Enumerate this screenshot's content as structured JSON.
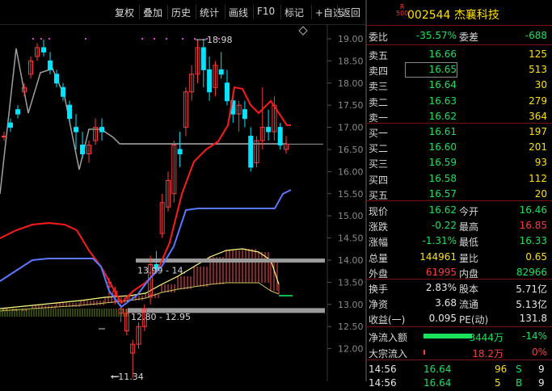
{
  "toolbar": {
    "buttons": [
      "复权",
      "叠加",
      "历史",
      "统计",
      "画线",
      "F10",
      "标记",
      "+自选",
      "返回"
    ]
  },
  "chart": {
    "price_ticks": [
      "19.00",
      "18.50",
      "18.00",
      "17.50",
      "17.00",
      "16.50",
      "16.00",
      "15.50",
      "15.00",
      "14.50",
      "14.00",
      "13.50",
      "13.00",
      "12.50",
      "12.00"
    ],
    "label_high": "18.98",
    "label_mid": "13.99 - 14.",
    "label_band": "12.80 - 12.95",
    "label_low": "11.34",
    "ref_line_price": 16.62,
    "upper_band_price": 14.0,
    "lower_band_price": 12.88,
    "colors": {
      "up": "#ff3b3b",
      "down": "#00e5ff",
      "ma_short": "#ff1a1a",
      "ma_long": "#5a78ff",
      "ma_gray": "#a0a0a0",
      "cloud": "#ffff80",
      "bars": "#ff5050"
    },
    "candles": [
      [
        16.8,
        16.9,
        16.7,
        16.8
      ],
      [
        17.1,
        17.2,
        16.9,
        17.0
      ],
      [
        17.4,
        17.5,
        17.2,
        17.3
      ],
      [
        17.8,
        18.0,
        17.7,
        17.9
      ],
      [
        18.2,
        18.6,
        18.1,
        18.5
      ],
      [
        18.6,
        18.9,
        18.5,
        18.8
      ],
      [
        18.8,
        18.98,
        18.6,
        18.7
      ],
      [
        18.5,
        18.7,
        18.2,
        18.3
      ],
      [
        18.2,
        18.3,
        17.9,
        18.0
      ],
      [
        17.9,
        18.0,
        17.6,
        17.7
      ],
      [
        17.5,
        17.6,
        17.1,
        17.2
      ],
      [
        17.0,
        17.3,
        16.5,
        16.9
      ],
      [
        16.6,
        16.9,
        16.3,
        16.4
      ],
      [
        16.4,
        16.7,
        16.2,
        16.6
      ],
      [
        16.7,
        17.2,
        16.6,
        17.0
      ],
      [
        17.0,
        17.2,
        16.7,
        16.9
      ],
      [
        13.4,
        13.6,
        13.2,
        13.5
      ],
      [
        13.2,
        13.4,
        13.0,
        13.3
      ],
      [
        12.8,
        13.0,
        12.6,
        12.9
      ],
      [
        12.4,
        12.9,
        12.3,
        12.8
      ],
      [
        11.9,
        12.2,
        11.34,
        12.1
      ],
      [
        12.1,
        12.6,
        12.0,
        12.5
      ],
      [
        12.5,
        13.0,
        12.4,
        12.9
      ],
      [
        13.2,
        14.1,
        13.0,
        13.9
      ],
      [
        13.9,
        14.2,
        13.7,
        13.8
      ],
      [
        14.6,
        15.5,
        14.5,
        15.3
      ],
      [
        15.2,
        16.0,
        15.1,
        15.8
      ],
      [
        15.5,
        16.7,
        15.3,
        16.6
      ],
      [
        16.5,
        16.9,
        16.1,
        16.4
      ],
      [
        17.0,
        17.9,
        16.8,
        17.8
      ],
      [
        17.8,
        18.4,
        17.6,
        18.2
      ],
      [
        18.2,
        18.98,
        18.0,
        18.8
      ],
      [
        18.8,
        19.0,
        17.9,
        18.3
      ],
      [
        18.3,
        18.6,
        17.6,
        17.8
      ],
      [
        17.9,
        18.5,
        17.7,
        18.4
      ],
      [
        18.3,
        18.7,
        18.1,
        18.2
      ],
      [
        18.0,
        18.3,
        17.5,
        17.6
      ],
      [
        17.6,
        17.8,
        17.1,
        17.3
      ],
      [
        17.3,
        17.6,
        16.9,
        17.5
      ],
      [
        17.4,
        17.6,
        17.0,
        17.2
      ],
      [
        16.8,
        17.0,
        16.0,
        16.1
      ],
      [
        16.2,
        16.8,
        16.1,
        16.7
      ],
      [
        16.7,
        17.9,
        16.5,
        17.0
      ],
      [
        17.0,
        17.4,
        16.7,
        16.9
      ],
      [
        16.9,
        17.7,
        16.7,
        17.5
      ],
      [
        17.0,
        17.1,
        16.5,
        16.6
      ],
      [
        16.5,
        16.8,
        16.4,
        16.62
      ]
    ]
  },
  "panel": {
    "r_label": "R",
    "r_sub": "500",
    "title": "002544 杰襄科技",
    "weibi": {
      "label": "委比",
      "value": "-35.57%",
      "label2": "委差",
      "value2": "-688"
    },
    "sell": [
      {
        "label": "卖五",
        "price": "16.66",
        "vol": "125"
      },
      {
        "label": "卖四",
        "price": "16.65",
        "vol": "513"
      },
      {
        "label": "卖三",
        "price": "16.64",
        "vol": "30"
      },
      {
        "label": "卖二",
        "price": "16.63",
        "vol": "279"
      },
      {
        "label": "卖一",
        "price": "16.62",
        "vol": "364"
      }
    ],
    "buy": [
      {
        "label": "买一",
        "price": "16.61",
        "vol": "197"
      },
      {
        "label": "买二",
        "price": "16.60",
        "vol": "201"
      },
      {
        "label": "买三",
        "price": "16.59",
        "vol": "93"
      },
      {
        "label": "买四",
        "price": "16.58",
        "vol": "112"
      },
      {
        "label": "买五",
        "price": "16.57",
        "vol": "20"
      }
    ],
    "quote": [
      {
        "l1": "现价",
        "v1": "16.62",
        "c1": "green",
        "l2": "今开",
        "v2": "16.46",
        "c2": "green"
      },
      {
        "l1": "涨跌",
        "v1": "-0.22",
        "c1": "green",
        "l2": "最高",
        "v2": "16.85",
        "c2": "red"
      },
      {
        "l1": "涨幅",
        "v1": "-1.31%",
        "c1": "green",
        "l2": "最低",
        "v2": "16.33",
        "c2": "green"
      },
      {
        "l1": "总量",
        "v1": "144961",
        "c1": "yellow",
        "l2": "量比",
        "v2": "0.65",
        "c2": "yellow"
      },
      {
        "l1": "外盘",
        "v1": "61995",
        "c1": "red",
        "l2": "内盘",
        "v2": "82966",
        "c2": "green"
      }
    ],
    "stats": [
      {
        "l1": "换手",
        "v1": "2.83%",
        "l2": "股本",
        "v2": "5.71亿"
      },
      {
        "l1": "净资",
        "v1": "3.68",
        "l2": "流通",
        "v2": "5.13亿"
      },
      {
        "l1": "收益(一)",
        "v1": "0.095",
        "l2": "PE(动)",
        "v2": "131.8"
      }
    ],
    "flow": [
      {
        "label": "净流入额",
        "value": "-3444万",
        "pct": "-14%",
        "bar_fraction": 0.6,
        "bar_color": "#19e35a",
        "value_color": "green"
      },
      {
        "label": "大宗流入",
        "value": "18.2万",
        "pct": "0%",
        "bar_fraction": 0.02,
        "bar_color": "#ff3b3b",
        "value_color": "red"
      }
    ],
    "ticks": [
      {
        "time": "14:56",
        "price": "16.64",
        "vol": "96",
        "dir": "S",
        "extra": "9"
      },
      {
        "time": "14:56",
        "price": "16.64",
        "vol": "5",
        "dir": "B",
        "extra": "9"
      }
    ]
  }
}
